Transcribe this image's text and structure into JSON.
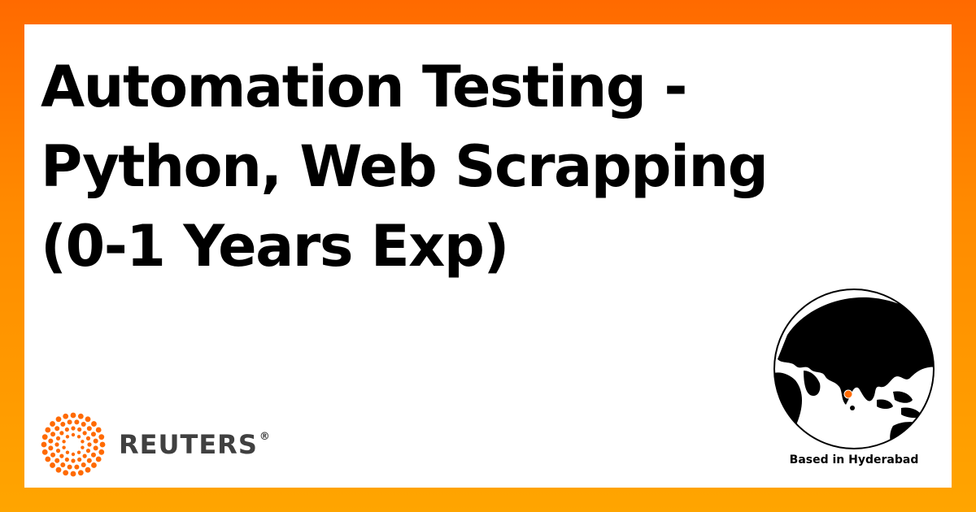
{
  "job": {
    "title_lines": [
      "Automation Testing -",
      "Python, Web Scrapping",
      "(0-1 Years Exp)"
    ]
  },
  "brand": {
    "name": "REUTERS",
    "registered_mark": "®",
    "accent_color": "#ff6a00"
  },
  "location": {
    "label": "Based in Hyderabad",
    "marker_color": "#ff6a00"
  },
  "background": {
    "gradient_top": "#ff6a00",
    "gradient_bottom": "#ffa500"
  }
}
